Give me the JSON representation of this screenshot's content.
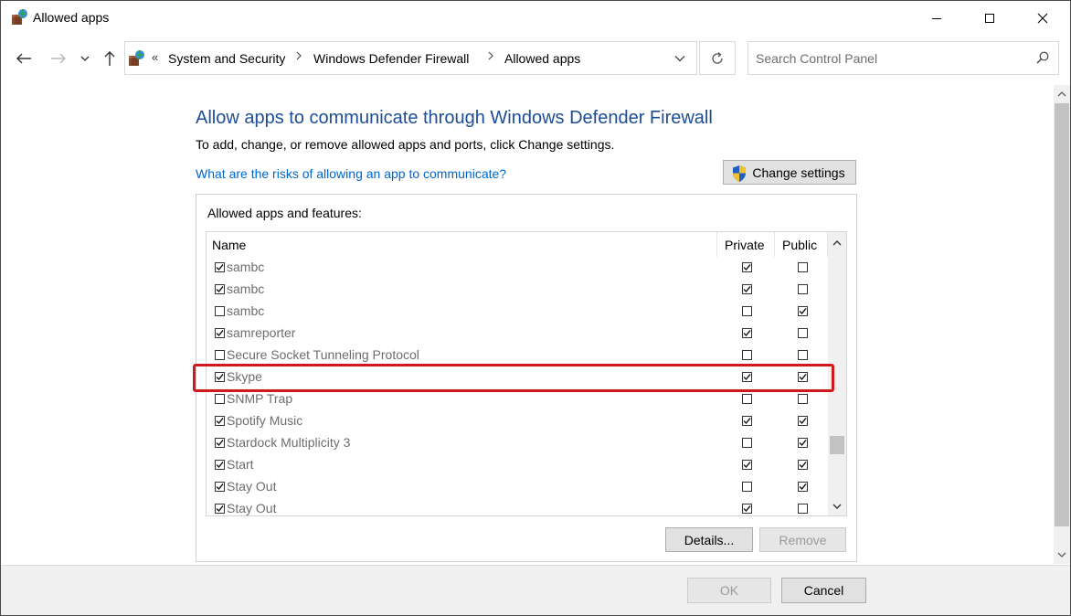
{
  "window": {
    "title": "Allowed apps",
    "icon": "control-panel-firewall-icon"
  },
  "address_bar": {
    "overflow_marker": "«",
    "breadcrumbs": [
      "System and Security",
      "Windows Defender Firewall",
      "Allowed apps"
    ],
    "search_placeholder": "Search Control Panel"
  },
  "main": {
    "heading": "Allow apps to communicate through Windows Defender Firewall",
    "description": "To add, change, or remove allowed apps and ports, click Change settings.",
    "risk_link": "What are the risks of allowing an app to communicate?",
    "change_settings_label": "Change settings",
    "group_label": "Allowed apps and features:",
    "columns": [
      "Name",
      "Private",
      "Public"
    ],
    "apps": [
      {
        "name": "sambc",
        "enabled": true,
        "private": true,
        "public": false
      },
      {
        "name": "sambc",
        "enabled": true,
        "private": true,
        "public": false
      },
      {
        "name": "sambc",
        "enabled": false,
        "private": false,
        "public": true
      },
      {
        "name": "samreporter",
        "enabled": true,
        "private": true,
        "public": false
      },
      {
        "name": "Secure Socket Tunneling Protocol",
        "enabled": false,
        "private": false,
        "public": false
      },
      {
        "name": "Skype",
        "enabled": true,
        "private": true,
        "public": true,
        "highlighted": true
      },
      {
        "name": "SNMP Trap",
        "enabled": false,
        "private": false,
        "public": false
      },
      {
        "name": "Spotify Music",
        "enabled": true,
        "private": true,
        "public": true
      },
      {
        "name": "Stardock Multiplicity 3",
        "enabled": true,
        "private": false,
        "public": true
      },
      {
        "name": "Start",
        "enabled": true,
        "private": true,
        "public": true
      },
      {
        "name": "Stay Out",
        "enabled": true,
        "private": false,
        "public": true
      },
      {
        "name": "Stay Out",
        "enabled": true,
        "private": true,
        "public": false
      }
    ],
    "details_label": "Details...",
    "remove_label": "Remove",
    "highlight_color": "#d0191c"
  },
  "footer": {
    "ok_label": "OK",
    "cancel_label": "Cancel"
  }
}
